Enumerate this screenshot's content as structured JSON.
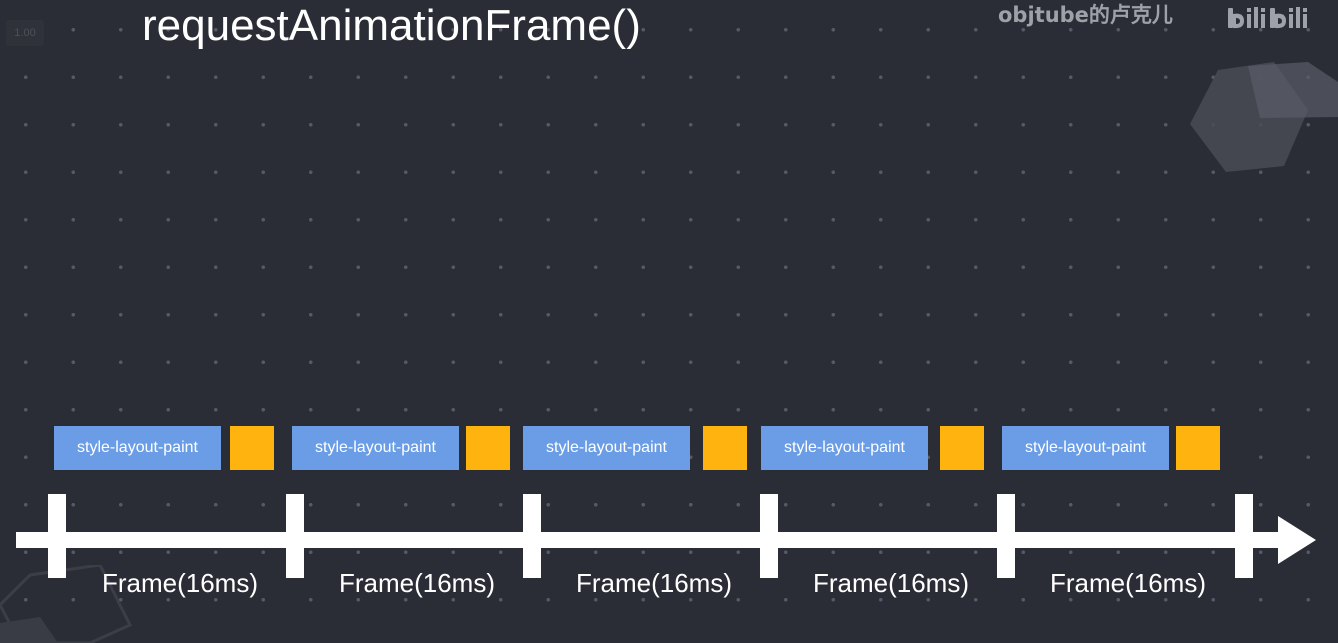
{
  "title": "requestAnimationFrame()",
  "speed_badge": "1.00",
  "watermark": {
    "text": "objtube的卢克儿",
    "logo": "bilibili-logo"
  },
  "colors": {
    "background": "#2b2d36",
    "task": "#6a9de6",
    "raf_callback": "#ffb30f",
    "timeline": "#ffffff"
  },
  "frames": [
    {
      "task_label": "style-layout-paint",
      "frame_label": "Frame(16ms)"
    },
    {
      "task_label": "style-layout-paint",
      "frame_label": "Frame(16ms)"
    },
    {
      "task_label": "style-layout-paint",
      "frame_label": "Frame(16ms)"
    },
    {
      "task_label": "style-layout-paint",
      "frame_label": "Frame(16ms)"
    },
    {
      "task_label": "style-layout-paint",
      "frame_label": "Frame(16ms)"
    }
  ]
}
